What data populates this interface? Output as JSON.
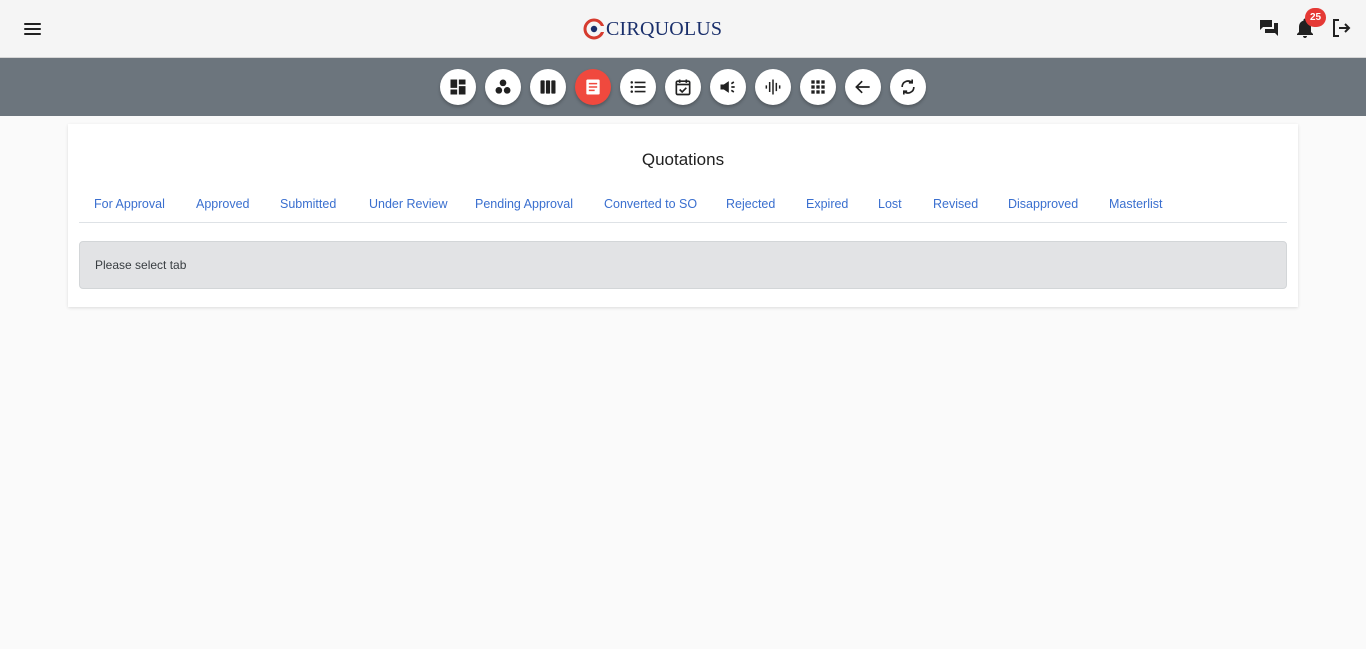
{
  "header": {
    "brand": "CIRQUOLUS",
    "notification_count": "25",
    "icons": [
      "menu-icon",
      "chat-icon",
      "bell-icon",
      "logout-icon"
    ]
  },
  "toolbar": {
    "buttons": [
      {
        "icon": "dashboard-icon"
      },
      {
        "icon": "workspaces-icon"
      },
      {
        "icon": "view-column-icon"
      },
      {
        "icon": "article-icon",
        "active": true
      },
      {
        "icon": "list-icon"
      },
      {
        "icon": "event-available-icon"
      },
      {
        "icon": "campaign-icon"
      },
      {
        "icon": "graphic-eq-icon"
      },
      {
        "icon": "apps-icon"
      },
      {
        "icon": "arrow-back-icon"
      },
      {
        "icon": "sync-icon"
      }
    ],
    "accent_color": "#f0493e"
  },
  "main": {
    "title": "Quotations",
    "tabs": [
      {
        "label": "For Approval"
      },
      {
        "label": "Approved"
      },
      {
        "label": "Submitted"
      },
      {
        "label": "Under Review"
      },
      {
        "label": "Pending Approval"
      },
      {
        "label": "Converted to SO"
      },
      {
        "label": "Rejected"
      },
      {
        "label": "Expired"
      },
      {
        "label": "Lost"
      },
      {
        "label": "Revised"
      },
      {
        "label": "Disapproved"
      },
      {
        "label": "Masterlist"
      }
    ],
    "message": "Please select tab"
  }
}
